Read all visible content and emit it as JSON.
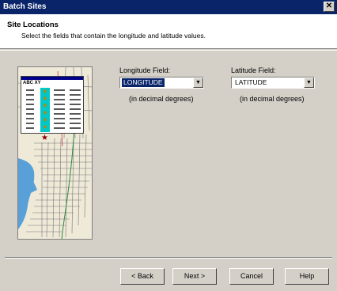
{
  "window": {
    "title": "Batch Sites",
    "close_glyph": "✕"
  },
  "header": {
    "title": "Site Locations",
    "subtitle": "Select the fields that contain the longitude and latitude values."
  },
  "map_preview": {
    "table_header": "ABC  XY",
    "icon": "map-with-table-icon"
  },
  "longitude": {
    "label": "Longitude Field:",
    "value": "LONGITUDE",
    "hint": "(in decimal degrees)"
  },
  "latitude": {
    "label": "Latitude Field:",
    "value": "LATITUDE",
    "hint": "(in decimal degrees)"
  },
  "buttons": {
    "back": "< Back",
    "next": "Next >",
    "cancel": "Cancel",
    "help": "Help"
  },
  "dropdown_glyph": "▼"
}
